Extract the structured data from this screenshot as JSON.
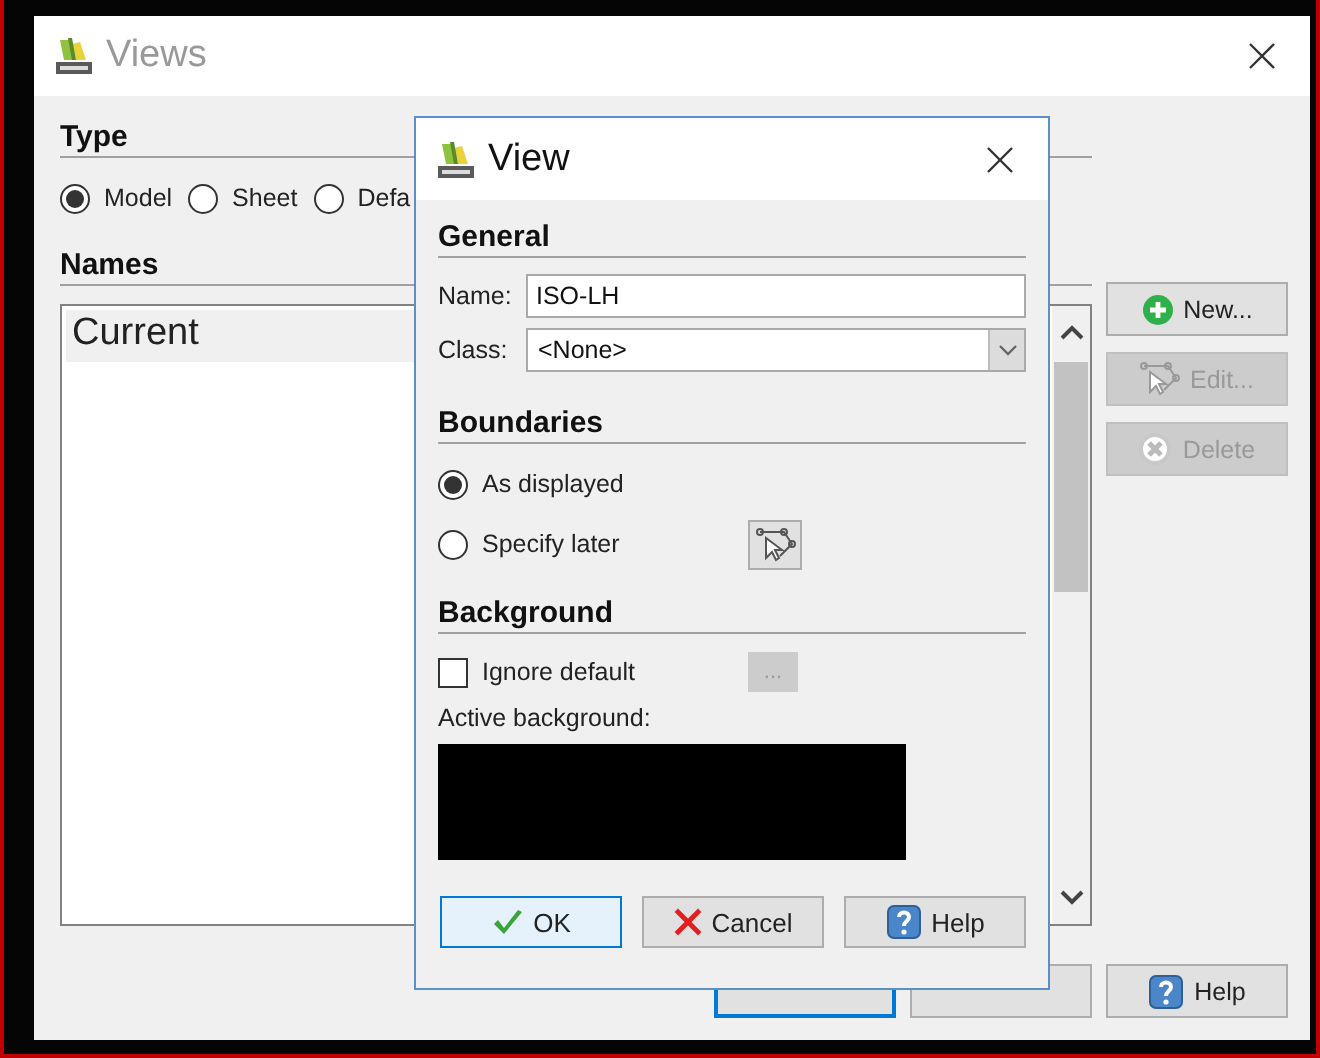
{
  "views_window": {
    "title": "Views",
    "type_heading": "Type",
    "type_options": [
      {
        "label": "Model",
        "selected": true
      },
      {
        "label": "Sheet",
        "selected": false
      },
      {
        "label": "Defa",
        "selected": false
      }
    ],
    "names_heading": "Names",
    "names": [
      {
        "label": "Current",
        "selected": true
      }
    ],
    "side_buttons": [
      {
        "label": "New...",
        "kind": "new",
        "disabled": false
      },
      {
        "label": "Edit...",
        "kind": "edit",
        "disabled": true
      },
      {
        "label": "Delete",
        "kind": "delete",
        "disabled": true
      }
    ],
    "buttons": [
      {
        "default": true
      },
      {
        "default": false
      },
      {
        "label": "Help",
        "kind": "help",
        "default": false
      }
    ]
  },
  "view_dialog": {
    "title": "View",
    "general_heading": "General",
    "name_label": "Name:",
    "name_value": "ISO-LH",
    "class_label": "Class:",
    "class_value": "<None>",
    "boundaries_heading": "Boundaries",
    "boundary_options": [
      {
        "label": "As displayed",
        "selected": true
      },
      {
        "label": "Specify later",
        "selected": false
      }
    ],
    "background_heading": "Background",
    "ignore_default": {
      "label": "Ignore default",
      "checked": false
    },
    "ellipsis_button": {
      "label": "...",
      "disabled": true
    },
    "active_background_label": "Active background:",
    "active_background": {
      "color": "#000000"
    },
    "buttons": [
      {
        "label": "OK",
        "kind": "ok",
        "default": true
      },
      {
        "label": "Cancel",
        "kind": "cancel",
        "default": false
      },
      {
        "label": "Help",
        "kind": "help",
        "default": false
      }
    ]
  }
}
